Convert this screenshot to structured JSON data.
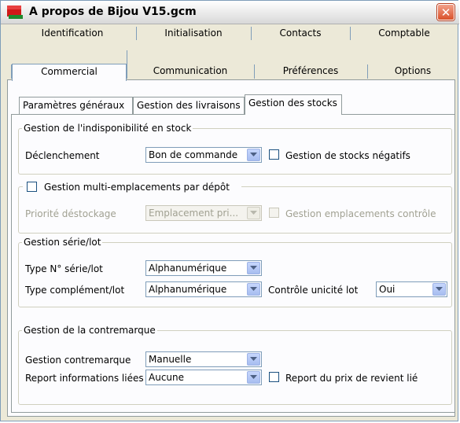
{
  "window": {
    "title": "A propos de Bijou V15.gcm",
    "close_glyph": "✕",
    "icon": "app-icon"
  },
  "tabs_row1": [
    "Identification",
    "Initialisation",
    "Contacts",
    "Comptable"
  ],
  "tabs_row2": [
    "Commercial",
    "Communication",
    "Préférences",
    "Options"
  ],
  "selected_tab": "Commercial",
  "subtabs": [
    "Paramètres généraux",
    "Gestion des livraisons",
    "Gestion des stocks"
  ],
  "selected_subtab": "Gestion des stocks",
  "indispo": {
    "legend": "Gestion de l'indisponibilité en stock",
    "declenchement_label": "Déclenchement",
    "declenchement_value": "Bon de commande",
    "negatifs_label": "Gestion de stocks négatifs",
    "negatifs_checked": false
  },
  "multi": {
    "legend_label": "Gestion multi-emplacements par dépôt",
    "checked": false,
    "priorite_label": "Priorité déstockage",
    "priorite_value": "Emplacement pri...",
    "controle_label": "Gestion emplacements contrôle",
    "controle_checked": false
  },
  "serie": {
    "legend": "Gestion série/lot",
    "type_serie_label": "Type N° série/lot",
    "type_serie_value": "Alphanumérique",
    "type_complement_label": "Type complément/lot",
    "type_complement_value": "Alphanumérique",
    "unicite_label": "Contrôle unicité lot",
    "unicite_value": "Oui"
  },
  "contremarque": {
    "legend": "Gestion de la contremarque",
    "gestion_label": "Gestion contremarque",
    "gestion_value": "Manuelle",
    "report_label": "Report informations liées",
    "report_value": "Aucune",
    "prix_label": "Report du prix de revient lié",
    "prix_checked": false
  },
  "colors": {
    "face": "#ece9d8",
    "border": "#7f9db9",
    "close": "#d9522b",
    "disabled_text": "#a1a192"
  }
}
